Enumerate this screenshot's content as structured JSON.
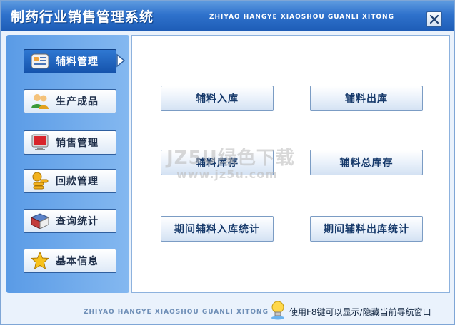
{
  "window": {
    "title": "制药行业销售管理系统",
    "title_pinyin": "ZHIYAO HANGYE XIAOSHOU GUANLI XITONG"
  },
  "sidebar": {
    "items": [
      {
        "label": "辅料管理",
        "icon": "notebook-icon",
        "active": true
      },
      {
        "label": "生产成品",
        "icon": "users-icon",
        "active": false
      },
      {
        "label": "销售管理",
        "icon": "monitor-icon",
        "active": false
      },
      {
        "label": "回款管理",
        "icon": "coins-icon",
        "active": false
      },
      {
        "label": "查询统计",
        "icon": "book-icon",
        "active": false
      },
      {
        "label": "基本信息",
        "icon": "star-icon",
        "active": false
      }
    ]
  },
  "main": {
    "buttons": [
      {
        "label": "辅料入库"
      },
      {
        "label": "辅料出库"
      },
      {
        "label": "辅料库存"
      },
      {
        "label": "辅料总库存"
      },
      {
        "label": "期间辅料入库统计"
      },
      {
        "label": "期间辅料出库统计"
      }
    ]
  },
  "status": {
    "pinyin": "ZHIYAO HANGYE XIAOSHOU GUANLI XITONG",
    "hint": "使用F8键可以显示/隐藏当前导航窗口"
  },
  "watermark": {
    "line1": "JZ5U绿色下载",
    "line2": "www.jz5u.com"
  },
  "colors": {
    "titlebar": "#2f72cc",
    "sidebar": "#6aa7ea",
    "active_item": "#1d5fb8",
    "button_text": "#173a6b"
  }
}
